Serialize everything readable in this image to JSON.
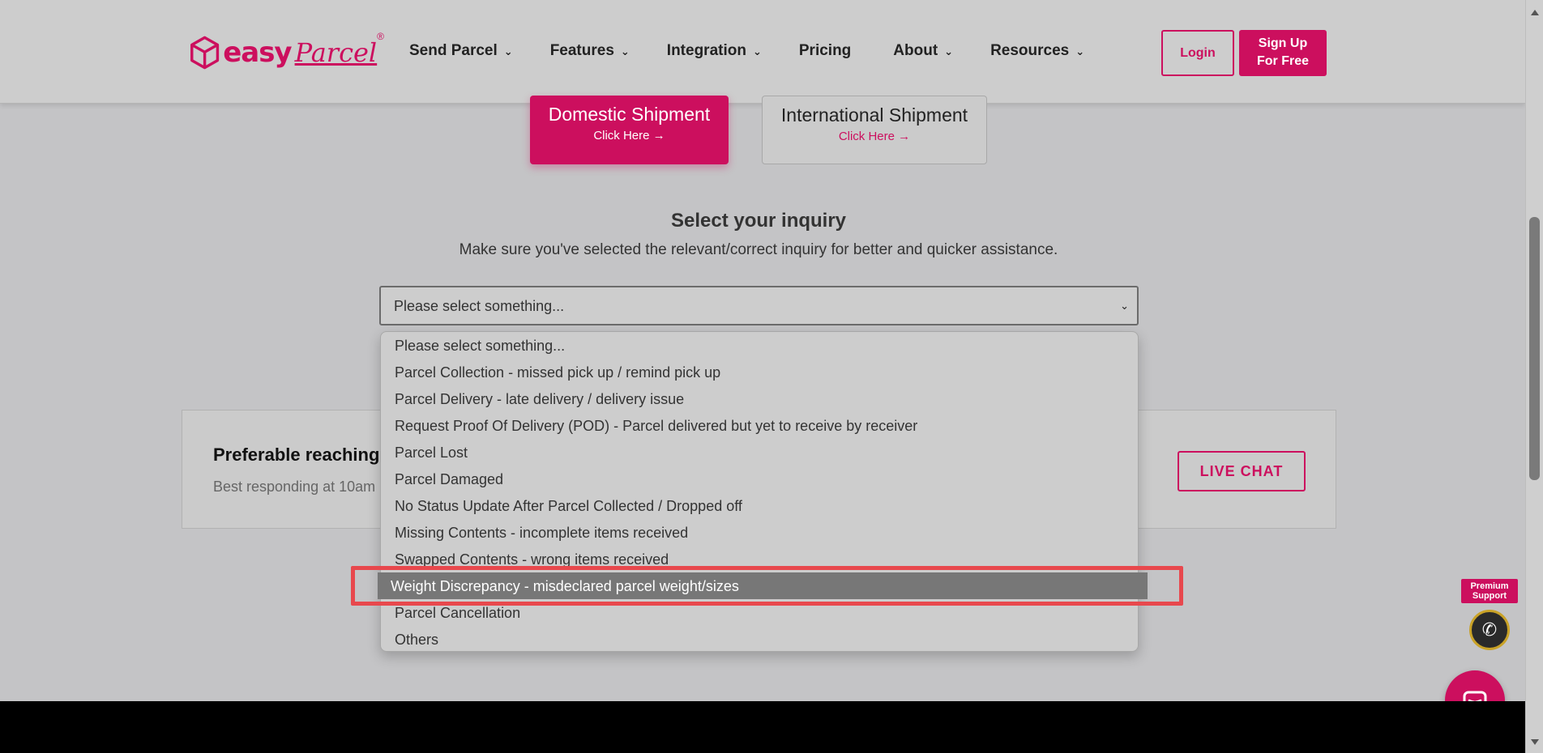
{
  "header": {
    "brand_easy": "easy",
    "brand_parcel": "Parcel",
    "nav": [
      {
        "label": "Send Parcel",
        "has_menu": true
      },
      {
        "label": "Features",
        "has_menu": true
      },
      {
        "label": "Integration",
        "has_menu": true
      },
      {
        "label": "Pricing",
        "has_menu": false
      },
      {
        "label": "About",
        "has_menu": true
      },
      {
        "label": "Resources",
        "has_menu": true
      }
    ],
    "login_label": "Login",
    "signup_line1": "Sign Up",
    "signup_line2": "For Free"
  },
  "shipment": {
    "domestic_title": "Domestic Shipment",
    "domestic_click": "Click Here →",
    "international_title": "International Shipment",
    "international_click": "Click Here →"
  },
  "inquiry": {
    "title": "Select your inquiry",
    "subtitle": "Make sure you've selected the relevant/correct inquiry for better and quicker assistance.",
    "selected_value": "Please select something...",
    "options": [
      "Please select something...",
      "Parcel Collection - missed pick up / remind pick up",
      "Parcel Delivery - late delivery / delivery issue",
      "Request Proof Of Delivery (POD) - Parcel delivered but yet to receive by receiver",
      "Parcel Lost",
      "Parcel Damaged",
      "No Status Update After Parcel Collected / Dropped off",
      "Missing Contents - incomplete items received",
      "Swapped Contents - wrong items received",
      "Weight Discrepancy - misdeclared parcel weight/sizes",
      "Parcel Cancellation",
      "Others"
    ],
    "highlighted_option": "Weight Discrepancy - misdeclared parcel weight/sizes"
  },
  "contact": {
    "prefer_text": "Preferable reaching t",
    "best_text": "Best responding at 10am",
    "live_chat_label": "LIVE CHAT"
  },
  "premium": {
    "tag_line1": "Premium",
    "tag_line2": "Support"
  },
  "colors": {
    "brand": "#cc0f5e",
    "highlight_frame": "#e8484d",
    "selected_option_bg": "#777777"
  }
}
